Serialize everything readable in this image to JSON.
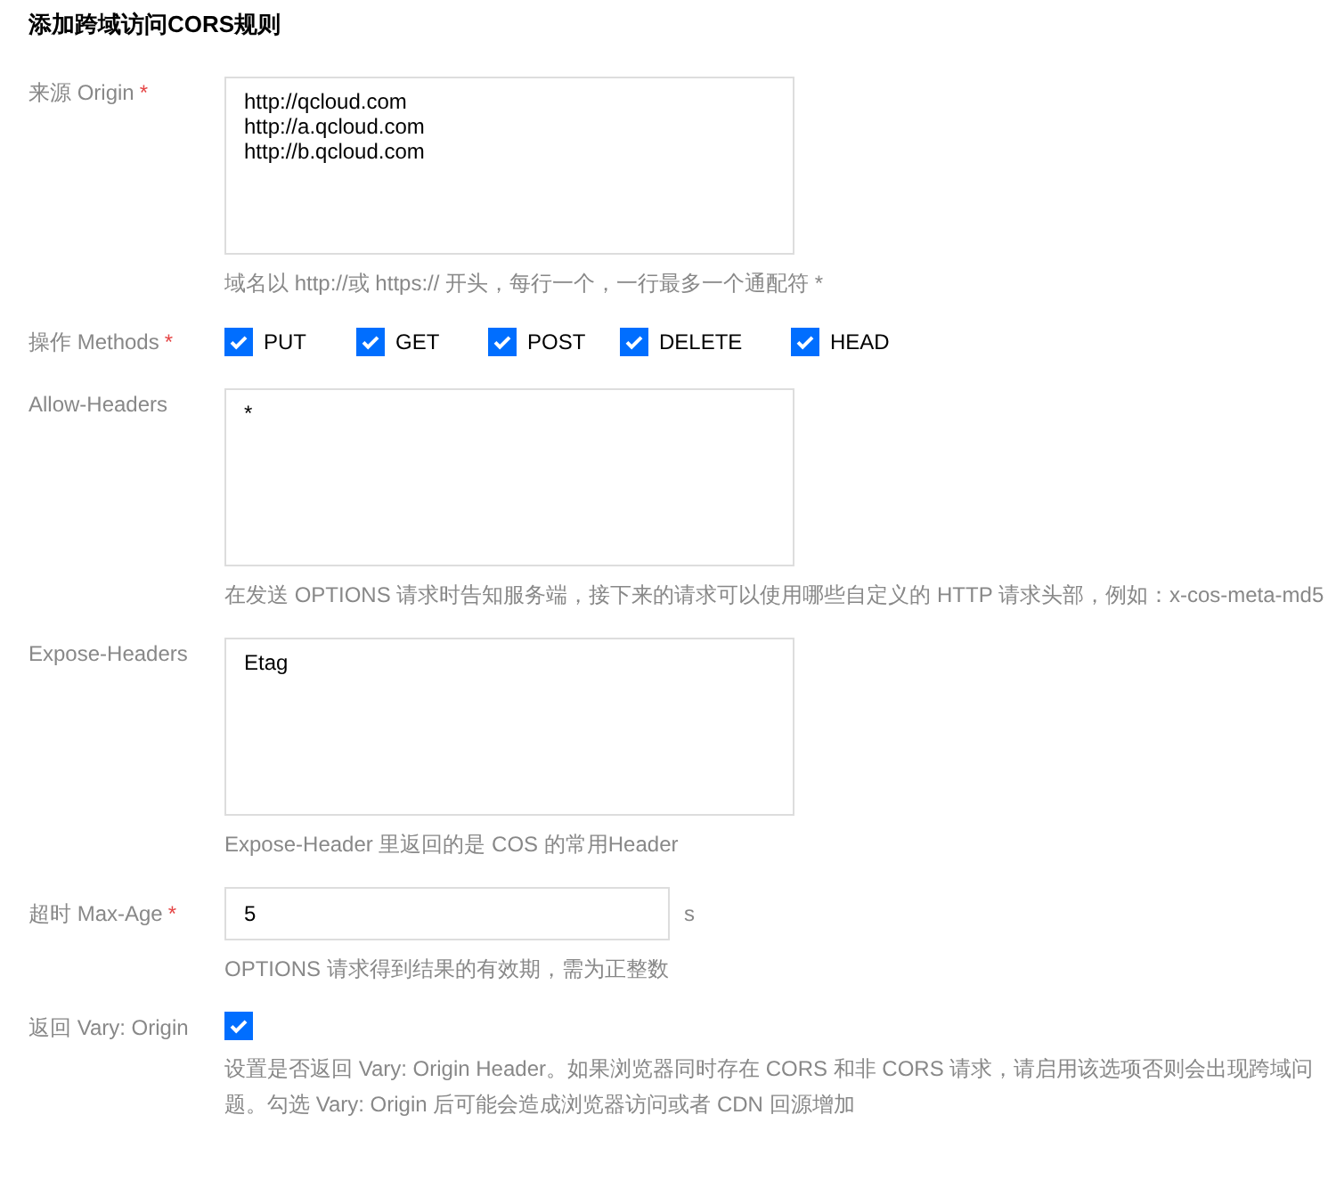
{
  "title": "添加跨域访问CORS规则",
  "fields": [
    {
      "kind": "textarea",
      "label": "来源 Origin",
      "required_mark": "*",
      "value": "http://qcloud.com\nhttp://a.qcloud.com\nhttp://b.qcloud.com",
      "hint": "域名以 http://或 https:// 开头，每行一个，一行最多一个通配符 *"
    },
    {
      "kind": "checkboxes",
      "label": "操作 Methods",
      "required_mark": "*",
      "options": [
        {
          "label": "PUT",
          "checked": true
        },
        {
          "label": "GET",
          "checked": true
        },
        {
          "label": "POST",
          "checked": true
        },
        {
          "label": "DELETE",
          "checked": true
        },
        {
          "label": "HEAD",
          "checked": true
        }
      ]
    },
    {
      "kind": "textarea",
      "label": "Allow-Headers",
      "value": "*",
      "hint": "在发送 OPTIONS 请求时告知服务端，接下来的请求可以使用哪些自定义的 HTTP 请求头部，例如：x-cos-meta-md5"
    },
    {
      "kind": "textarea",
      "label": "Expose-Headers",
      "value": "Etag",
      "hint": "Expose-Header 里返回的是 COS 的常用Header"
    },
    {
      "kind": "input",
      "label": "超时 Max-Age",
      "required_mark": "*",
      "value": "5",
      "unit": "s",
      "hint": "OPTIONS 请求得到结果的有效期，需为正整数"
    },
    {
      "kind": "checkbox",
      "label": "返回 Vary: Origin",
      "checked": true,
      "hint": "设置是否返回 Vary: Origin Header。如果浏览器同时存在 CORS 和非 CORS 请求，请启用该选项否则会出现跨域问题。勾选 Vary: Origin 后可能会造成浏览器访问或者 CDN 回源增加"
    }
  ]
}
